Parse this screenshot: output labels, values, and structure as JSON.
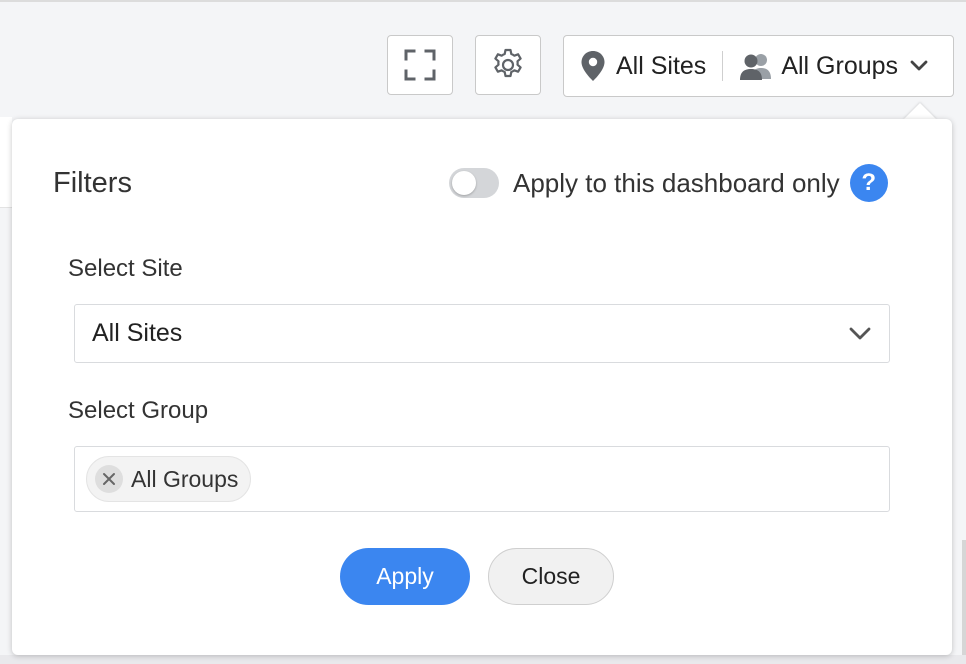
{
  "toolbar": {
    "fullscreen_icon": "fullscreen-icon",
    "settings_icon": "gear-icon",
    "selector": {
      "site_label": "All Sites",
      "group_label": "All Groups",
      "site_icon": "location-pin-icon",
      "group_icon": "users-icon"
    }
  },
  "filters": {
    "title": "Filters",
    "dashboard_only": {
      "label": "Apply to this dashboard only",
      "enabled": false,
      "help": "?"
    },
    "site": {
      "label": "Select Site",
      "value": "All Sites"
    },
    "group": {
      "label": "Select Group",
      "chips": [
        "All Groups"
      ]
    },
    "buttons": {
      "apply": "Apply",
      "close": "Close"
    }
  },
  "colors": {
    "accent": "#3b86f0",
    "icon_gray": "#5f6368",
    "toggle_off": "#d4d6d9"
  }
}
